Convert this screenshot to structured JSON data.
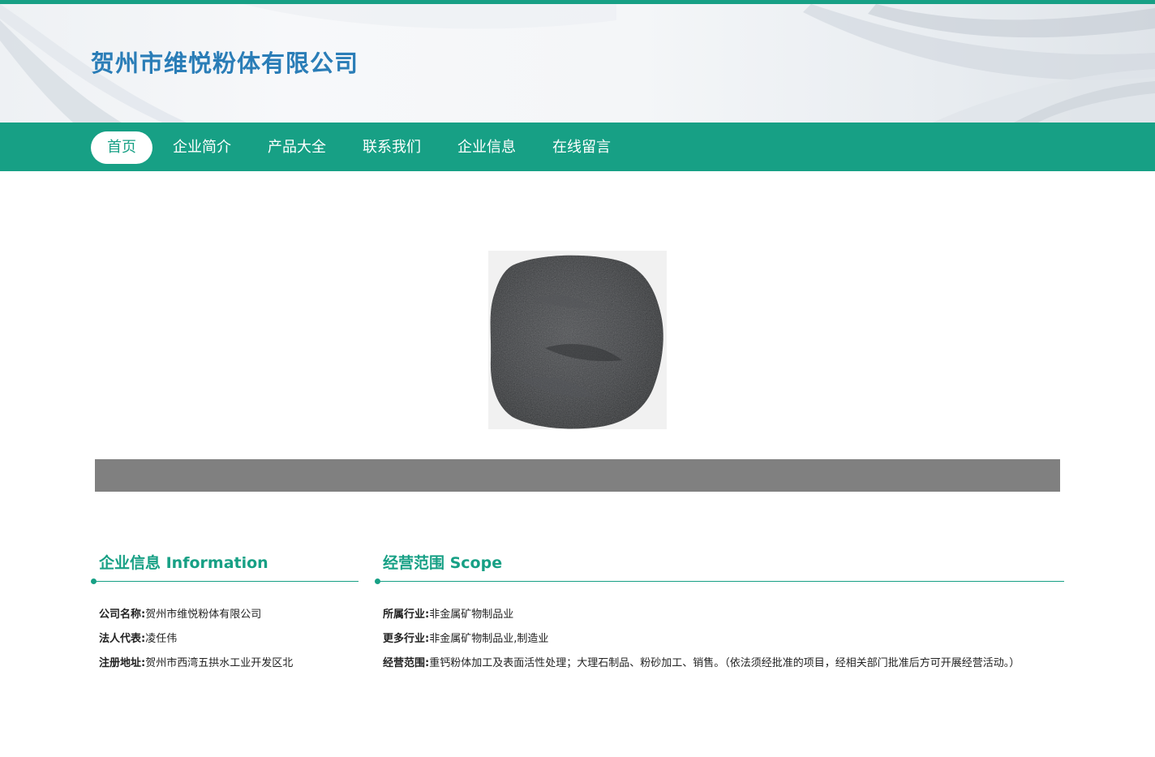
{
  "site": {
    "title": "贺州市维悦粉体有限公司"
  },
  "nav": {
    "items": [
      {
        "label": "首页",
        "active": true
      },
      {
        "label": "企业简介",
        "active": false
      },
      {
        "label": "产品大全",
        "active": false
      },
      {
        "label": "联系我们",
        "active": false
      },
      {
        "label": "企业信息",
        "active": false
      },
      {
        "label": "在线留言",
        "active": false
      }
    ]
  },
  "colors": {
    "brand": "#17a085",
    "title": "#2a7db7",
    "banner_bar": "#808080"
  },
  "product_image": {
    "icon": "black-powder-image"
  },
  "company_info": {
    "heading": "企业信息 Information",
    "rows": [
      {
        "label": "公司名称:",
        "value": "贺州市维悦粉体有限公司"
      },
      {
        "label": "法人代表:",
        "value": "凌任伟"
      },
      {
        "label": "注册地址:",
        "value": "贺州市西湾五拱水工业开发区北"
      }
    ]
  },
  "scope": {
    "heading": "经营范围 Scope",
    "rows": [
      {
        "label": "所属行业:",
        "value": "非金属矿物制品业"
      },
      {
        "label": "更多行业:",
        "value": "非金属矿物制品业,制造业"
      }
    ],
    "business": {
      "label": "经营范围:",
      "value": "重钙粉体加工及表面活性处理；大理石制品、粉砂加工、销售。（依法须经批准的项目，经相关部门批准后方可开展经营活动。）"
    }
  }
}
